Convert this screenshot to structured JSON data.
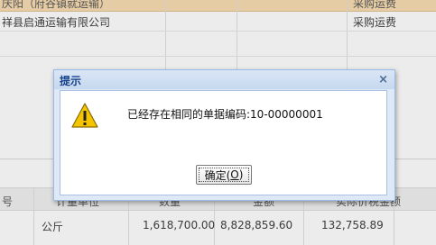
{
  "grid": {
    "header_partial": "庆阳（府谷镇就运输）",
    "header_right": "采购运费",
    "row1_company": "祥县启通运输有限公司",
    "row1_type": "采购运费"
  },
  "detail": {
    "col_no": "号",
    "col_unit": "计量单位",
    "col_qty": "数量",
    "col_amount": "金额",
    "col_tax": "实际价税金额",
    "row1": {
      "unit": "公斤",
      "qty": "1,618,700.00",
      "amount": "8,828,859.60",
      "tax": "132,758.89"
    }
  },
  "dialog": {
    "title": "提示",
    "close_icon": "×",
    "message": "已经存在相同的单据编码:10-00000001",
    "ok_label": "确定(",
    "ok_mnemonic": "O",
    "ok_suffix": ")"
  },
  "icons": {
    "warning": "warning-icon",
    "close": "close-icon"
  },
  "colors": {
    "header_bg": "#f6d49f",
    "dialog_title": "#15428b",
    "dialog_frame": "#dfe8f6",
    "warning_yellow": "#f5c400"
  }
}
